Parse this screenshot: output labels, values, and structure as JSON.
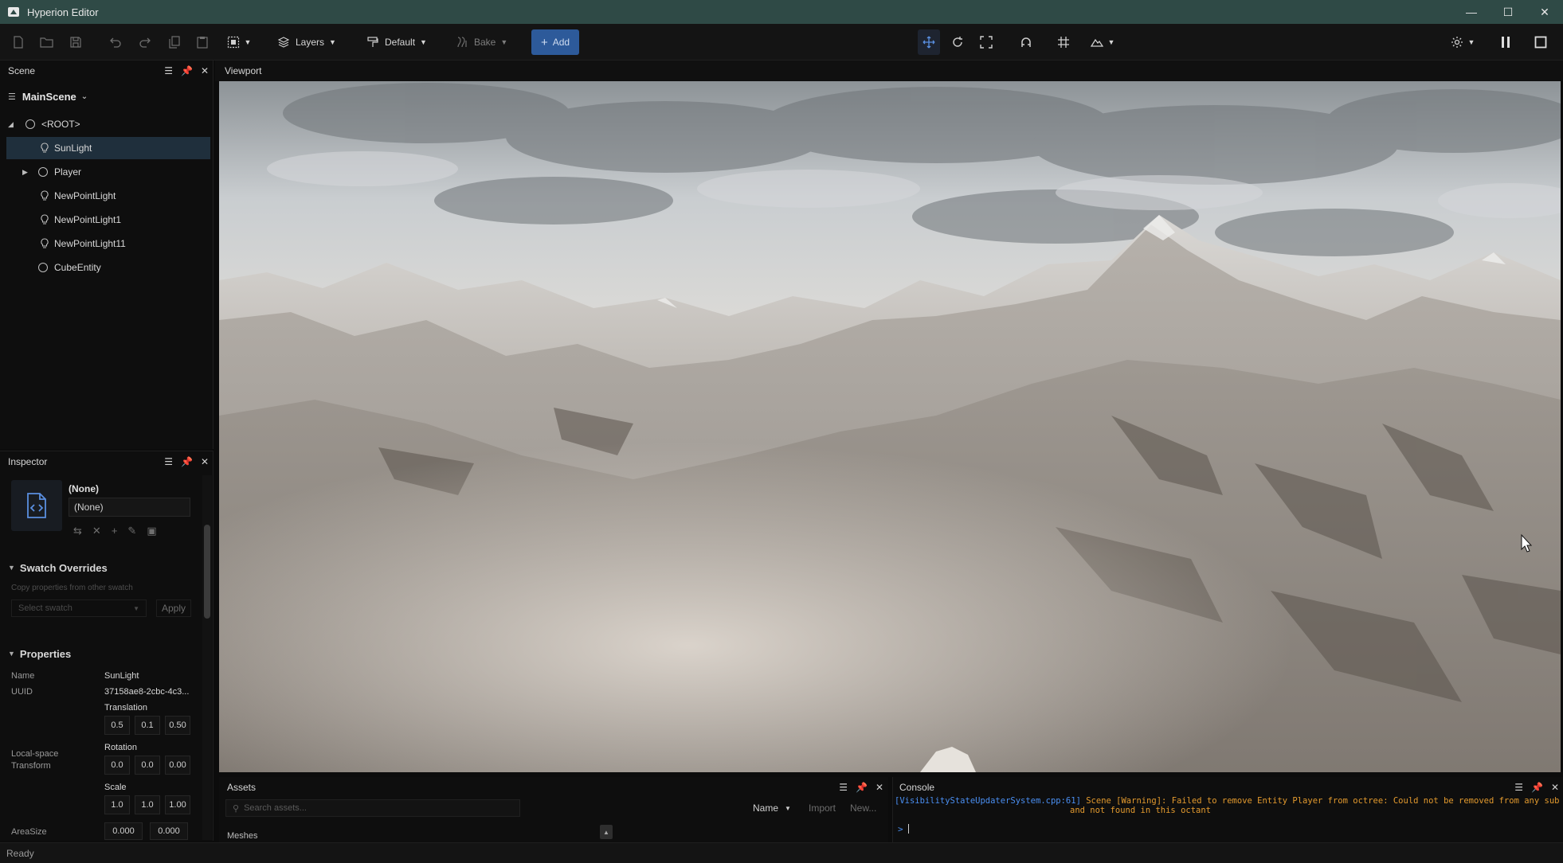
{
  "window": {
    "title": "Hyperion Editor"
  },
  "toolbar": {
    "layers_label": "Layers",
    "default_label": "Default",
    "bake_label": "Bake",
    "add_label": "Add"
  },
  "scene": {
    "panel_title": "Scene",
    "scene_name": "MainScene",
    "items": [
      {
        "label": "<ROOT>"
      },
      {
        "label": "SunLight"
      },
      {
        "label": "Player"
      },
      {
        "label": "NewPointLight"
      },
      {
        "label": "NewPointLight1"
      },
      {
        "label": "NewPointLight11"
      },
      {
        "label": "CubeEntity"
      }
    ]
  },
  "inspector": {
    "panel_title": "Inspector",
    "asset_title": "(None)",
    "asset_field": "(None)",
    "swatch": {
      "title": "Swatch Overrides",
      "hint": "Copy properties from other swatch",
      "select_placeholder": "Select swatch",
      "apply_label": "Apply"
    },
    "properties": {
      "title": "Properties",
      "name_label": "Name",
      "name_value": "SunLight",
      "uuid_label": "UUID",
      "uuid_value": "37158ae8-2cbc-4c3...",
      "local_space_label": "Local-space",
      "transform_label": "Transform",
      "translation_label": "Translation",
      "translation": [
        "0.5",
        "0.1",
        "0.50"
      ],
      "rotation_label": "Rotation",
      "rotation": [
        "0.0",
        "0.0",
        "0.00"
      ],
      "scale_label": "Scale",
      "scale": [
        "1.0",
        "1.0",
        "1.00"
      ],
      "areasize_label": "AreaSize",
      "areasize": [
        "0.000",
        "0.000"
      ]
    }
  },
  "viewport": {
    "tab_label": "Viewport"
  },
  "assets": {
    "panel_title": "Assets",
    "search_placeholder": "Search assets...",
    "sort_label": "Name",
    "import_label": "Import",
    "new_label": "New...",
    "category_label": "Meshes"
  },
  "console": {
    "panel_title": "Console",
    "log_source": "[VisibilityStateUpdaterSystem.cpp:61]",
    "log_message": "Scene [Warning]: Failed to remove Entity Player from octree: Could not be removed from any sub octants",
    "log_continuation": "and not found in this octant",
    "prompt": ">"
  },
  "status": {
    "text": "Ready"
  },
  "colors": {
    "accent": "#2d5a9a",
    "title_bar": "#2f4a46",
    "log_source": "#4a8ff2",
    "log_warning": "#e39a2e"
  }
}
